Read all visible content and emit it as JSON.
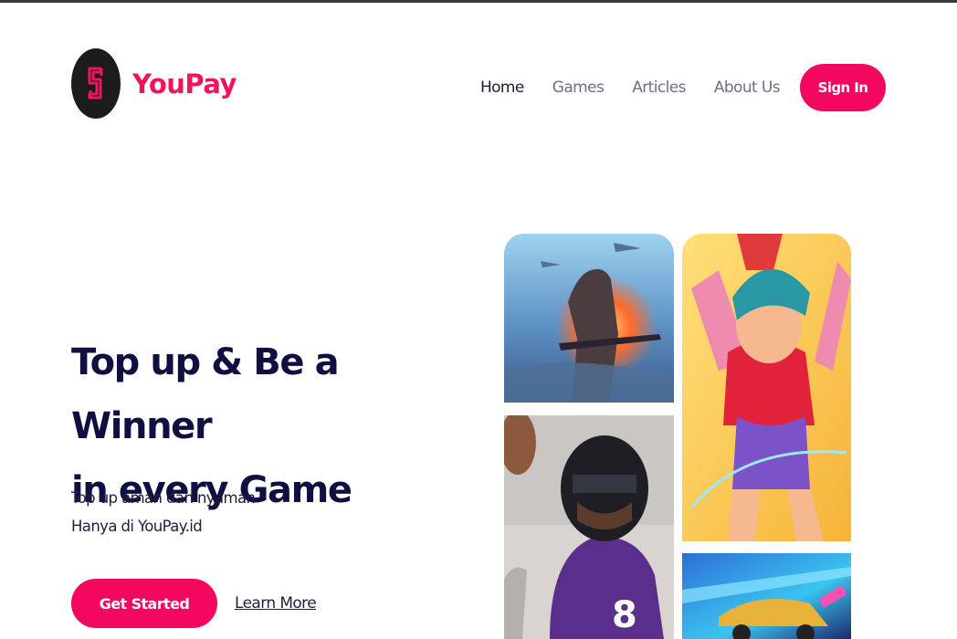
{
  "brand": {
    "name": "YouPay"
  },
  "nav": {
    "items": [
      {
        "label": "Home",
        "active": true
      },
      {
        "label": "Games"
      },
      {
        "label": "Articles"
      },
      {
        "label": "About Us"
      }
    ],
    "signin_label": "Sign In"
  },
  "hero": {
    "title_line1": "Top up & Be a Winner",
    "title_line2": "in every Game",
    "sub_line1": "Top up aman dan nyaman",
    "sub_line2": "Hanya di YouPay.id",
    "get_started_label": "Get Started",
    "learn_more_label": "Learn More"
  },
  "colors": {
    "accent": "#f4075f",
    "heading": "#0f1041",
    "nav": "#6b6f86"
  },
  "icons": {
    "logo": "youpay-logo-icon"
  }
}
